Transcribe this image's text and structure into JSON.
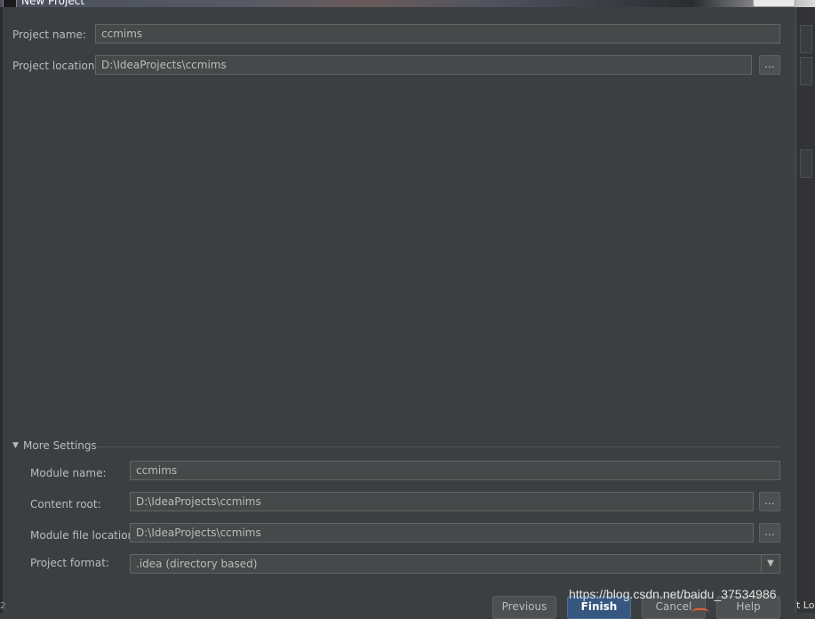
{
  "window": {
    "title": "New Project"
  },
  "project": {
    "name_label": "Project name:",
    "name_value": "ccmims",
    "location_label": "Project location:",
    "location_value": "D:\\IdeaProjects\\ccmims",
    "browse_label": "..."
  },
  "more_settings": {
    "header": "More Settings",
    "module_name_label": "Module name:",
    "module_name_value": "ccmims",
    "content_root_label": "Content root:",
    "content_root_value": "D:\\IdeaProjects\\ccmims",
    "module_file_label": "Module file location:",
    "module_file_value": "D:\\IdeaProjects\\ccmims",
    "project_format_label": "Project format:",
    "project_format_value": ".idea (directory based)"
  },
  "buttons": {
    "previous": "Previous",
    "finish": "Finish",
    "cancel": "Cancel",
    "help": "Help"
  },
  "watermark": "https://blog.csdn.net/baidu_37534986",
  "corner_left": "2",
  "corner_right": "t Lo"
}
